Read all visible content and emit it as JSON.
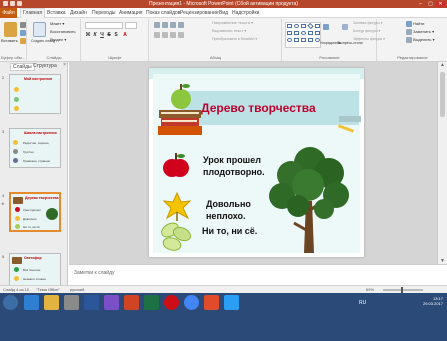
{
  "window": {
    "title": "Презентация1 - Microsoft PowerPoint (Сбой активации продукта)",
    "controls": [
      "–",
      "▢",
      "✕"
    ]
  },
  "tabs": [
    {
      "label": "Файл"
    },
    {
      "label": "Главная"
    },
    {
      "label": "Вставка"
    },
    {
      "label": "Дизайн"
    },
    {
      "label": "Переходы"
    },
    {
      "label": "Анимация"
    },
    {
      "label": "Показ слайдов"
    },
    {
      "label": "Рецензирование"
    },
    {
      "label": "Вид"
    },
    {
      "label": "Надстройки"
    }
  ],
  "ribbon": {
    "clipboard": {
      "label": "Буфер обм...",
      "paste": "Вставить",
      "cut": "",
      "copy": "",
      "format": ""
    },
    "slides": {
      "label": "Слайды",
      "new_slide": "Создать слайд",
      "layout": "Макет ▾",
      "reset": "Восстановить",
      "section": "Раздел ▾"
    },
    "font": {
      "label": "Шрифт"
    },
    "paragraph": {
      "label": "Абзац",
      "text_dir": "Направление текста ▾",
      "align_text": "Выровнять текст ▾",
      "smartart": "Преобразовать в SmartArt ▾"
    },
    "drawing": {
      "label": "Рисование",
      "arrange": "Упорядочить",
      "styles": "Экспресс-стили",
      "fill": "Заливка фигуры ▾",
      "outline": "Контур фигуры ▾",
      "effects": "Эффекты фигуры ▾"
    },
    "editing": {
      "label": "Редактирование",
      "find": "Найти",
      "replace": "Заменить ▾",
      "select": "Выделить ▾"
    }
  },
  "panel": {
    "tabs": [
      {
        "label": "Слайды"
      },
      {
        "label": "Структура"
      }
    ],
    "close": "×",
    "slides": [
      {
        "num": "2",
        "title": "Мой настроение",
        "bullets": [
          "",
          ""
        ]
      },
      {
        "num": "3",
        "title": "Шкала настроения",
        "bullets": [
          "Радостно, хорошо,",
          "Грустно",
          "Тревожно, страшно"
        ]
      },
      {
        "num": "4",
        "title": "Дерево творчества",
        "bullets": [
          "Урок прошел",
          "Довольно",
          "Ни то, ни сё"
        ]
      },
      {
        "num": "5",
        "title": "Светофор",
        "bullets": [
          "Всё понятно",
          "Немного сложно",
          "Очень сложно"
        ]
      }
    ]
  },
  "slide": {
    "title": "Дерево творчества",
    "items": [
      {
        "text": "Урок прошел\nплодотворно.",
        "icon": "apple-icon"
      },
      {
        "text": "Довольно\nнеплохо.",
        "icon": "yellow-leaf-icon"
      },
      {
        "text": "Ни то, ни сё.",
        "icon": "green-leaves-icon"
      }
    ]
  },
  "notes": {
    "placeholder": "Заметки к слайду"
  },
  "status": {
    "slide_counter": "Слайд 4 из 10",
    "theme": "\"Тема Office\"",
    "language": "русский",
    "zoom": "69%"
  },
  "taskbar": {
    "lang": "RU",
    "time": "13:17",
    "date": "29.03.2017"
  },
  "colors": {
    "accent": "#b7472a",
    "slide_title": "#c0002d",
    "selected_thumb": "#e68a2e",
    "taskbar": "#2c4a78"
  }
}
